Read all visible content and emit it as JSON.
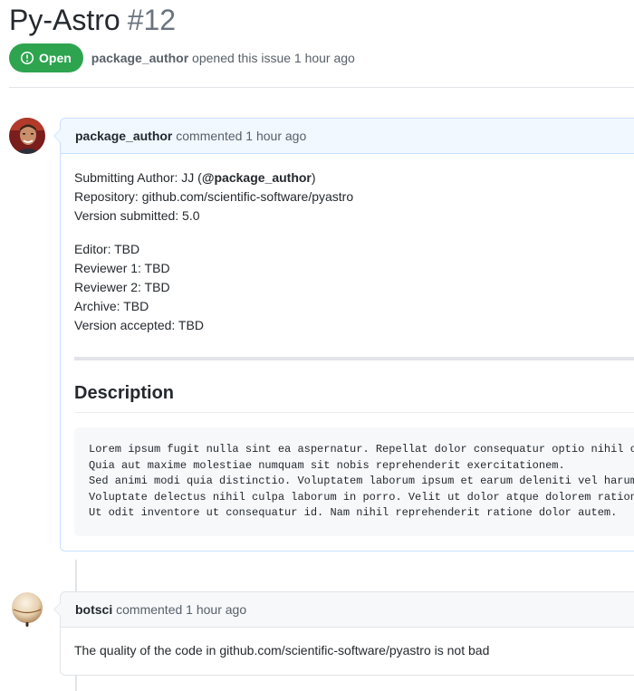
{
  "issue": {
    "title": "Py-Astro",
    "number": "#12",
    "state_label": "Open",
    "state_color": "#2ea44f",
    "author": "package_author",
    "opened_text": "opened this issue 1 hour ago"
  },
  "comments": [
    {
      "author": "package_author",
      "action": "commented 1 hour ago",
      "avatar": "person-avatar",
      "body": {
        "submitting_author_label": "Submitting Author: JJ (",
        "submitting_author_mention": "@package_author",
        "submitting_author_close": ")",
        "repository": "Repository: github.com/scientific-software/pyastro",
        "version_submitted": "Version submitted: 5.0",
        "editor": "Editor: TBD",
        "reviewer_1": "Reviewer 1: TBD",
        "reviewer_2": "Reviewer 2: TBD",
        "archive": "Archive: TBD",
        "version_accepted": "Version accepted: TBD",
        "description_heading": "Description",
        "description_lines": [
          "Lorem ipsum fugit nulla sint ea aspernatur. Repellat dolor consequatur optio nihil o",
          "Quia aut maxime molestiae numquam sit nobis reprehenderit exercitationem.",
          "Sed animi modi quia distinctio. Voluptatem laborum ipsum et earum deleniti vel harum",
          "Voluptate delectus nihil culpa laborum in porro. Velit ut dolor atque dolorem ration",
          "Ut odit inventore ut consequatur id. Nam nihil reprehenderit ratione dolor autem."
        ]
      }
    },
    {
      "author": "botsci",
      "action": "commented 1 hour ago",
      "avatar": "bot-avatar",
      "body": {
        "text": "The quality of the code in github.com/scientific-software/pyastro is not bad"
      }
    }
  ]
}
